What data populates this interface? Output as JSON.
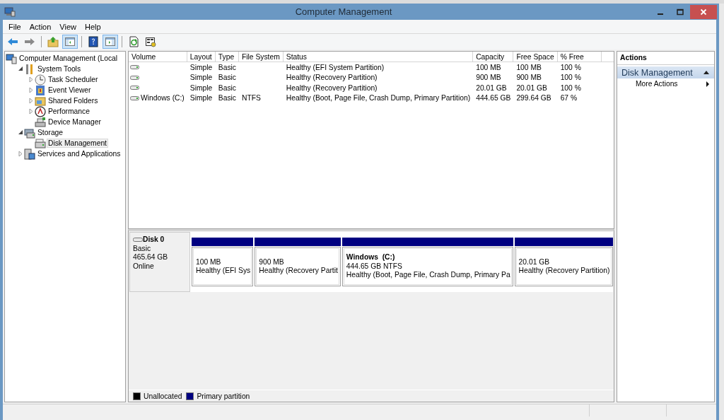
{
  "window": {
    "title": "Computer Management"
  },
  "menu": [
    "File",
    "Action",
    "View",
    "Help"
  ],
  "toolbar": [
    {
      "kind": "back",
      "pressed": false
    },
    {
      "kind": "forward",
      "pressed": false
    },
    {
      "kind": "sep"
    },
    {
      "kind": "up",
      "pressed": false
    },
    {
      "kind": "tree-pane",
      "pressed": true
    },
    {
      "kind": "sep"
    },
    {
      "kind": "help",
      "pressed": false
    },
    {
      "kind": "action-pane",
      "pressed": true
    },
    {
      "kind": "sep"
    },
    {
      "kind": "refresh",
      "pressed": false
    },
    {
      "kind": "properties",
      "pressed": false
    }
  ],
  "tree": [
    {
      "label": "Computer Management (Local",
      "kind": "computer",
      "selected": false,
      "children": [
        {
          "label": "System Tools",
          "kind": "tools",
          "expanded": true,
          "selected": false,
          "children": [
            {
              "label": "Task Scheduler",
              "kind": "clock",
              "expanded": false,
              "selected": false
            },
            {
              "label": "Event Viewer",
              "kind": "event",
              "expanded": false,
              "selected": false
            },
            {
              "label": "Shared Folders",
              "kind": "share",
              "expanded": false,
              "selected": false
            },
            {
              "label": "Performance",
              "kind": "perf",
              "expanded": false,
              "selected": false
            },
            {
              "label": "Device Manager",
              "kind": "device",
              "selected": false
            }
          ]
        },
        {
          "label": "Storage",
          "kind": "storage",
          "expanded": true,
          "selected": false,
          "children": [
            {
              "label": "Disk Management",
              "kind": "disk",
              "selected": true
            }
          ]
        },
        {
          "label": "Services and Applications",
          "kind": "services",
          "expanded": false,
          "selected": false
        }
      ]
    }
  ],
  "volumes": {
    "columns": [
      "Volume",
      "Layout",
      "Type",
      "File System",
      "Status",
      "Capacity",
      "Free Space",
      "% Free"
    ],
    "rows": [
      {
        "layout": "Simple",
        "type": "Basic",
        "status": "Healthy (EFI System Partition)",
        "capacity": "100 MB",
        "free": "100 MB",
        "pct": "100 %"
      },
      {
        "layout": "Simple",
        "type": "Basic",
        "status": "Healthy (Recovery Partition)",
        "capacity": "900 MB",
        "free": "900 MB",
        "pct": "100 %"
      },
      {
        "layout": "Simple",
        "type": "Basic",
        "status": "Healthy (Recovery Partition)",
        "capacity": "20.01 GB",
        "free": "20.01 GB",
        "pct": "100 %"
      },
      {
        "volume": "Windows (C:)",
        "layout": "Simple",
        "type": "Basic",
        "fs": "NTFS",
        "status": "Healthy (Boot, Page File, Crash Dump, Primary Partition)",
        "capacity": "444.65 GB",
        "free": "299.64 GB",
        "pct": "67 %"
      }
    ]
  },
  "disk": {
    "name": "Disk 0",
    "type": "Basic",
    "size": "465.64 GB",
    "state": "Online",
    "partitions": [
      {
        "size": "100 MB",
        "status": "Healthy (EFI Sys"
      },
      {
        "size": "900 MB",
        "status": "Healthy (Recovery Partit"
      },
      {
        "name": "Windows  (C:)",
        "size": "444.65 GB NTFS",
        "status": "Healthy (Boot, Page File, Crash Dump, Primary Pa"
      },
      {
        "size": "20.01 GB",
        "status": "Healthy (Recovery Partition)"
      }
    ]
  },
  "legend": [
    {
      "label": "Unallocated",
      "color": "#000000"
    },
    {
      "label": "Primary partition",
      "color": "#000080"
    }
  ],
  "actions": {
    "header": "Actions",
    "section": {
      "title": "Disk Management",
      "expanded": true
    },
    "items": [
      "More Actions"
    ]
  }
}
